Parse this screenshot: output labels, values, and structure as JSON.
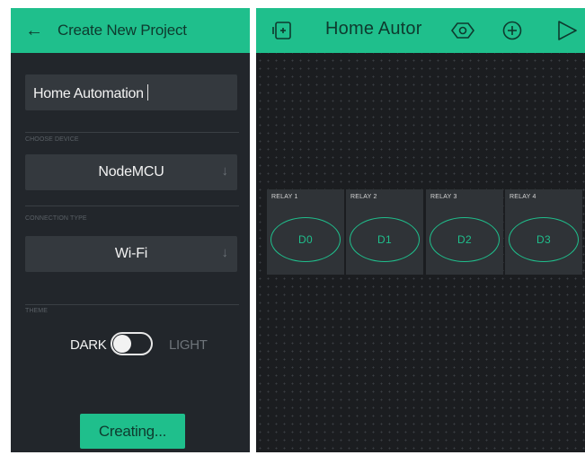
{
  "create_project": {
    "title": "Create New Project",
    "back_icon": "arrow-left-icon",
    "project_name": "Home Automation",
    "device": {
      "label": "CHOOSE DEVICE",
      "value": "NodeMCU",
      "arrow_icon": "arrow-down-icon"
    },
    "connection": {
      "label": "CONNECTION TYPE",
      "value": "Wi-Fi",
      "arrow_icon": "arrow-down-icon"
    },
    "theme": {
      "label": "THEME",
      "dark_label": "DARK",
      "light_label": "LIGHT",
      "selected": "DARK"
    },
    "create_button_label": "Creating..."
  },
  "dashboard": {
    "title": "Home Autor",
    "icons": [
      "widget-box-icon",
      "settings-hexagon-icon",
      "add-widget-icon",
      "play-icon"
    ],
    "relays": [
      {
        "label": "RELAY 1",
        "button": "D0"
      },
      {
        "label": "RELAY 2",
        "button": "D1"
      },
      {
        "label": "RELAY 3",
        "button": "D2"
      },
      {
        "label": "RELAY 4",
        "button": "D3"
      }
    ]
  },
  "colors": {
    "accent": "#1fbf8c",
    "panel_bg": "#22262b",
    "canvas_bg": "#1b1d20",
    "field_bg": "#34393e"
  }
}
